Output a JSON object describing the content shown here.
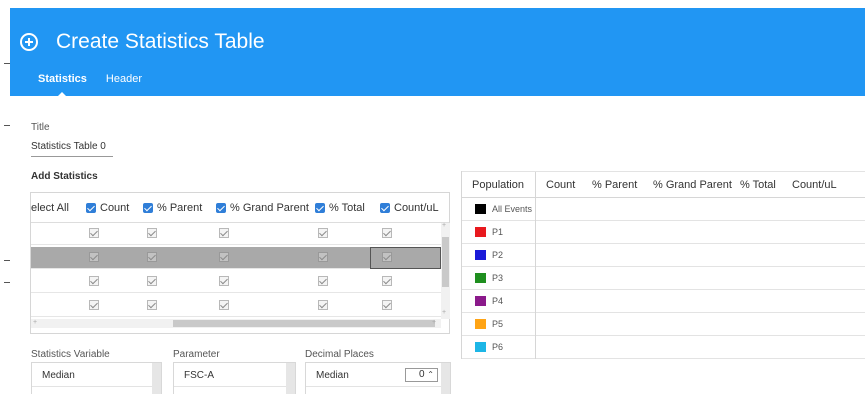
{
  "dialog": {
    "title": "Create Statistics Table",
    "tabs": [
      {
        "label": "Statistics"
      },
      {
        "label": "Header"
      }
    ]
  },
  "form": {
    "title_label": "Title",
    "title_value": "Statistics Table 0",
    "add_statistics_label": "Add Statistics"
  },
  "grid": {
    "headers": [
      "elect All",
      "Count",
      "% Parent",
      "% Grand Parent",
      "% Total",
      "Count/uL"
    ],
    "row_count": 4,
    "selected_row": 2
  },
  "lists": {
    "statistics_variable": {
      "label": "Statistics Variable",
      "item": "Median"
    },
    "parameter": {
      "label": "Parameter",
      "item": "FSC-A"
    },
    "decimal_places": {
      "label": "Decimal Places",
      "item": "Median",
      "value": "0"
    }
  },
  "table": {
    "headers": [
      "Population",
      "Count",
      "% Parent",
      "% Grand Parent",
      "% Total",
      "Count/uL"
    ],
    "populations": [
      {
        "name": "All Events",
        "color": "#000000"
      },
      {
        "name": "P1",
        "color": "#e8191e"
      },
      {
        "name": "P2",
        "color": "#1a1ad8"
      },
      {
        "name": "P3",
        "color": "#1f8f1f"
      },
      {
        "name": "P4",
        "color": "#8b1a8b"
      },
      {
        "name": "P5",
        "color": "#ffa415"
      },
      {
        "name": "P6",
        "color": "#1db6e6"
      }
    ]
  }
}
